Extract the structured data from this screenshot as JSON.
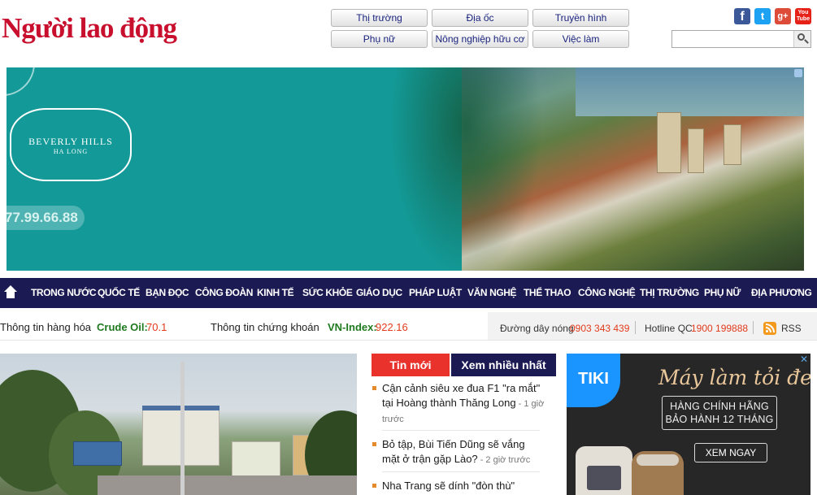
{
  "site": {
    "logo_text": "Người lao động"
  },
  "top_links": [
    {
      "label": "Thị trường"
    },
    {
      "label": "Địa ốc"
    },
    {
      "label": "Truyền hình"
    },
    {
      "label": "Phụ nữ"
    },
    {
      "label": "Nông nghiệp hữu cơ"
    },
    {
      "label": "Việc làm"
    }
  ],
  "social": {
    "facebook": "f",
    "twitter": "t",
    "googleplus": "g+",
    "youtube_line1": "You",
    "youtube_line2": "Tube"
  },
  "search": {
    "placeholder": "",
    "value": ""
  },
  "banner_ad": {
    "brand_line1": "BEVERLY HILLS",
    "brand_line2": "HA LONG",
    "phone": "77.99.66.88"
  },
  "nav": {
    "items": [
      "TRONG NƯỚC",
      "QUỐC TẾ",
      "BẠN ĐỌC",
      "CÔNG ĐOÀN",
      "KINH TẾ",
      "SỨC KHỎE",
      "GIÁO DỤC",
      "PHÁP LUẬT",
      "VĂN NGHỆ",
      "THỂ THAO",
      "CÔNG NGHỆ",
      "THỊ TRƯỜNG",
      "PHỤ NỮ",
      "ĐỊA PHƯƠNG"
    ]
  },
  "market": {
    "commodity_label": "Thông tin hàng hóa",
    "commodity_name": "Crude Oil:",
    "commodity_value": "70.1",
    "stock_label": "Thông tin chứng khoán",
    "stock_name": "VN-Index:",
    "stock_value": "922.16"
  },
  "hotline": {
    "hot_label": "Đường dây nóng",
    "hot_number": "0903 343 439",
    "ad_label": "Hotline QC",
    "ad_number": "1900 199888",
    "rss_label": "RSS"
  },
  "news_tabs": {
    "latest": "Tin mới",
    "most_viewed": "Xem nhiều nhất"
  },
  "news_items": [
    {
      "title": "Cận cảnh siêu xe đua F1 \"ra mắt\" tại Hoàng thành Thăng Long",
      "time": " - 1 giờ trước"
    },
    {
      "title": "Bỏ tập, Bùi Tiến Dũng sẽ vắng mặt ở trận gặp Lào?",
      "time": " - 2 giờ trước"
    },
    {
      "title": "Nha Trang sẽ dính \"đòn thù\"",
      "time": ""
    }
  ],
  "tiki_ad": {
    "brand": "TIKI",
    "slogan": "Máy làm tỏi đen",
    "box_line1": "HÀNG CHÍNH HÃNG",
    "box_line2": "BẢO HÀNH 12 THÁNG",
    "cta": "XEM NGAY"
  },
  "colors": {
    "logo_red": "#c8102e",
    "nav_bg": "#1c1a53",
    "tab_red": "#e8322b",
    "price_red": "#e23a1c",
    "market_green": "#1f7a1f",
    "ad_teal": "#139a98"
  }
}
